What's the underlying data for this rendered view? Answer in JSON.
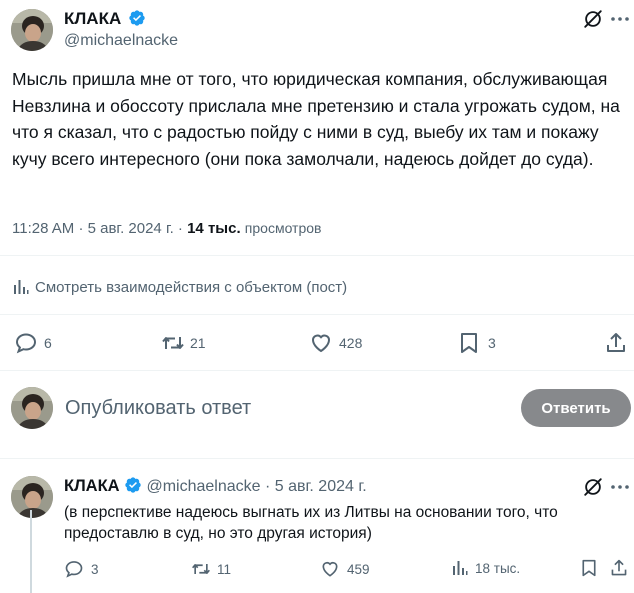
{
  "main_tweet": {
    "author_name": "КЛАКА",
    "handle": "@michaelnacke",
    "text": "Мысль пришла мне от того, что юридическая компания, обслуживающая Невзлина и обоссоту прислала мне претензию и стала угрожать судом, на что я сказал, что с радостью пойду с ними в суд, выебу их там и покажу кучу всего интересного (они пока замолчали, надеюсь дойдет до суда).",
    "time": "11:28 AM",
    "separator": "·",
    "date": "5 авг. 2024 г.",
    "views_count": "14 тыс.",
    "views_label": "просмотров",
    "engagements_label": "Смотреть взаимодействия с объектом (пост)",
    "stats": {
      "replies": "6",
      "reposts": "21",
      "likes": "428",
      "bookmarks": "3"
    }
  },
  "compose": {
    "placeholder": "Опубликовать ответ",
    "button_label": "Ответить"
  },
  "reply_tweet": {
    "author_name": "КЛАКА",
    "handle": "@michaelnacke",
    "separator": "·",
    "date": "5 авг. 2024 г.",
    "text": "(в перспективе надеюсь выгнать их из Литвы на основании того, что предоставлю в суд, но это другая история)",
    "stats": {
      "replies": "3",
      "reposts": "11",
      "likes": "459",
      "views": "18 тыс."
    }
  },
  "colors": {
    "text": "#0f1419",
    "secondary": "#536471",
    "verified": "#1d9bf0",
    "button_disabled": "#87898c",
    "divider": "#eff3f4"
  },
  "icons": [
    "verified-badge-icon",
    "grok-icon",
    "analytics-icon",
    "reply-icon",
    "repost-icon",
    "like-icon",
    "bookmark-icon",
    "share-icon"
  ]
}
